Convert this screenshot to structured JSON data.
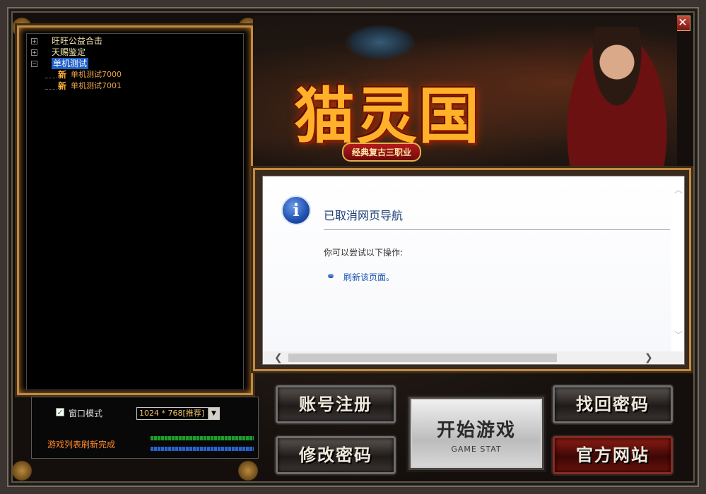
{
  "window": {
    "minimize_glyph": "—",
    "close_glyph": "✕"
  },
  "server_tree": {
    "groups": [
      {
        "expander": "+",
        "label": "旺旺公益合击"
      },
      {
        "expander": "+",
        "label": "天赐鉴定"
      },
      {
        "expander": "−",
        "label": "单机测试",
        "selected": true
      }
    ],
    "children": [
      {
        "tag": "新",
        "label": "单机测试7000"
      },
      {
        "tag": "新",
        "label": "单机测试7001"
      }
    ]
  },
  "options": {
    "window_mode_label": "窗口模式",
    "window_mode_checked": true,
    "check_glyph": "✓",
    "resolution_value": "1024 * 768[推荐]",
    "dropdown_glyph": "▼",
    "status_text": "游戏列表刷新完成"
  },
  "banner": {
    "logo_text": "猫灵国",
    "logo_subtitle": "经典复古三职业"
  },
  "browser": {
    "info_glyph": "i",
    "title": "已取消网页导航",
    "subtitle": "你可以尝试以下操作:",
    "link": "刷新该页面。",
    "scroll_up": "︿",
    "scroll_down": "﹀",
    "scroll_left": "❮",
    "scroll_right": "❯"
  },
  "buttons": {
    "register": "账号注册",
    "change_password": "修改密码",
    "start_main": "开始游戏",
    "start_sub": "GAME STAT",
    "recover_password": "找回密码",
    "official_site": "官方网站"
  },
  "colors": {
    "frame_gold": "#c48a3c",
    "selected_blue": "#1e5fc7",
    "status_orange": "#ff8a2a"
  }
}
